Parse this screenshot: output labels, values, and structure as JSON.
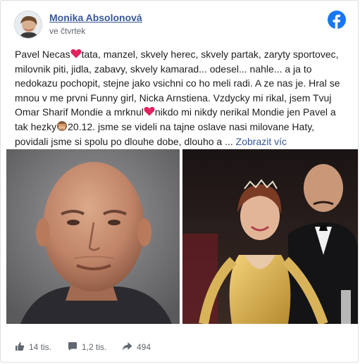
{
  "post": {
    "author": "Monika Absolonová",
    "date": "ve čtvrtek",
    "text_before_heart1": "Pavel Necas",
    "text_after_heart1": "tata, manzel, skvely herec, skvely partak, zaryty sportovec, milovnik piti, jidla, zabavy, skvely kamarad... odesel... nahle... a ja to nedokazu pochopit, stejne jako vsichni co ho meli radi. A ze nas je. Hral se mnou v me prvni Funny girl, Nicka Arnstiena. Vzdycky mi rikal, jsem Tvuj Omar Sharif Mondie a mrknul",
    "text_after_heart2": "nikdo mi nikdy nerikal Mondie jen Pavel a tak hezky",
    "text_after_monkey": "20.12. jsme se videli na tajne oslave nasi milovane Haty, povidali jsme si spolu po dlouhe dobe, dlouho a ...",
    "see_more": "Zobrazit víc"
  },
  "stats": {
    "likes": "14 tis.",
    "comments": "1,2 tis.",
    "shares": "494"
  },
  "icons": {
    "brand": "facebook-icon",
    "like": "thumbs-up-icon",
    "comment": "comment-icon",
    "share": "share-arrow-icon",
    "emoji_heart": "red-heart-emoji",
    "emoji_monkey": "see-no-evil-monkey-emoji"
  },
  "colors": {
    "brand_blue": "#1877f2",
    "link_blue": "#365899",
    "heart_red": "#e0245e"
  }
}
